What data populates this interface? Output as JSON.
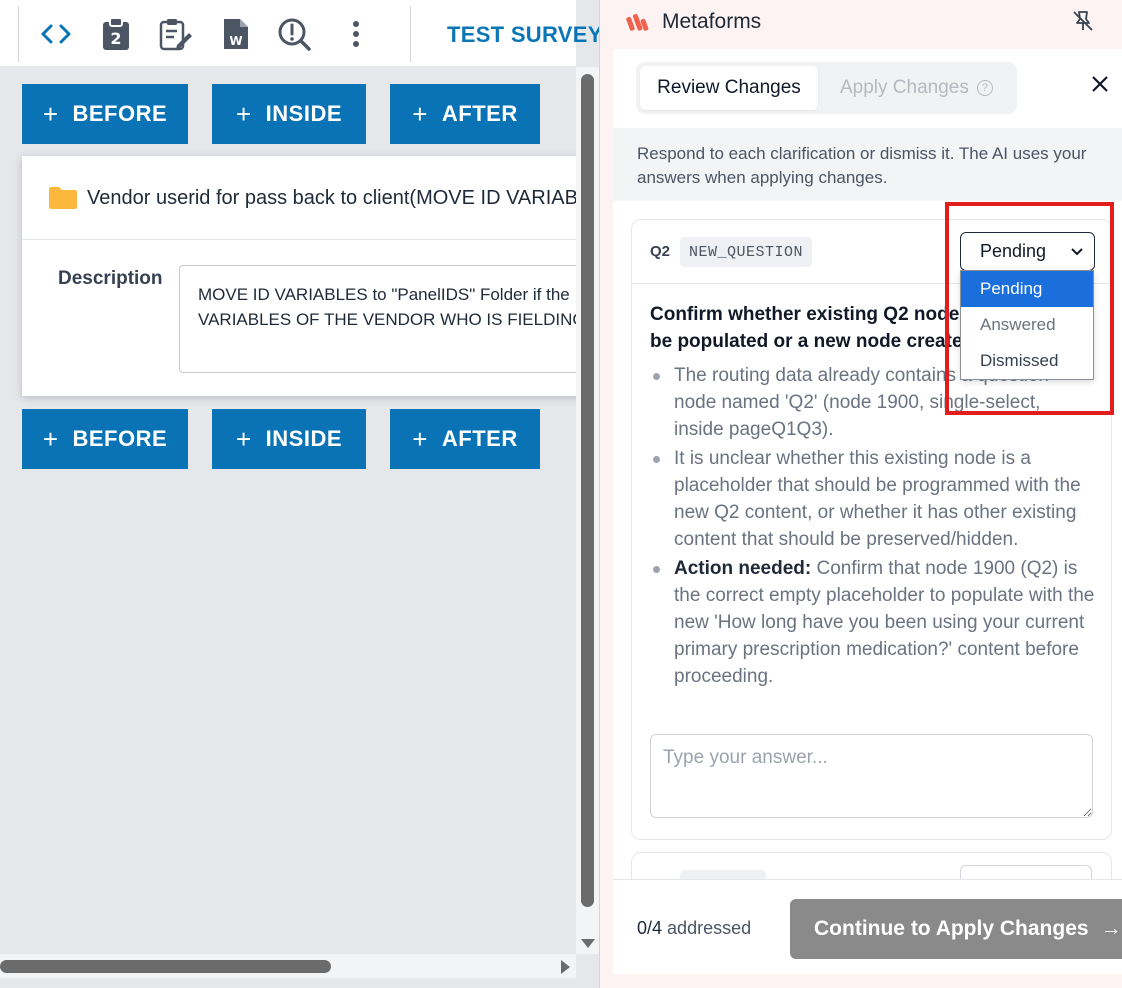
{
  "toolbar": {
    "survey_title": "TEST SURVEY",
    "icons": [
      "code-icon",
      "clipboard-2-icon",
      "edit-clipboard-icon",
      "word-doc-icon",
      "search-alert-icon",
      "more-vertical-icon"
    ]
  },
  "editor": {
    "buttons_top": {
      "before": "BEFORE",
      "inside": "INSIDE",
      "after": "AFTER"
    },
    "buttons_bottom": {
      "before": "BEFORE",
      "inside": "INSIDE",
      "after": "AFTER"
    },
    "plus": "+",
    "node": {
      "title": "Vendor userid for pass back to client(MOVE ID VARIABLES",
      "description_label": "Description",
      "description_line1": "MOVE ID VARIABLES to \"PanelIDS\" Folder if the",
      "description_line2": "VARIABLES OF THE VENDOR WHO IS FIELDING I"
    }
  },
  "panel": {
    "brand": "Metaforms",
    "tabs": {
      "review": "Review Changes",
      "apply": "Apply Changes",
      "apply_help": "?"
    },
    "info": "Respond to each clarification or dismiss it. The AI uses your answers when applying changes.",
    "card": {
      "qid": "Q2",
      "qtype": "NEW_QUESTION",
      "status": "Pending",
      "title_line1": "Confirm whether existing Q2 node",
      "title_line2": "be populated or a new node create",
      "bullets": [
        {
          "bold": "",
          "text": "The routing data already contains a question node named 'Q2' (node 1900, single-select, inside pageQ1Q3)."
        },
        {
          "bold": "",
          "text": "It is unclear whether this existing node is a placeholder that should be programmed with the new Q2 content, or whether it has other existing content that should be preserved/hidden."
        },
        {
          "bold": "Action needed:",
          "text": " Confirm that node 1900 (Q2) is the correct empty placeholder to populate with the new 'How long have you been using your current primary prescription medication?' content before proceeding."
        }
      ],
      "answer_placeholder": "Type your answer..."
    },
    "dropdown": {
      "options": [
        "Pending",
        "Answered",
        "Dismissed"
      ],
      "selected": "Pending"
    },
    "footer": {
      "addressed_count": "0/4",
      "addressed_label": "addressed",
      "continue": "Continue to Apply Changes",
      "arrow": "→"
    }
  },
  "colors": {
    "primary_blue": "#0a73b6",
    "highlight_red": "#e11d1d",
    "select_blue": "#1a6fdd",
    "brand_orange": "#f0624d"
  }
}
